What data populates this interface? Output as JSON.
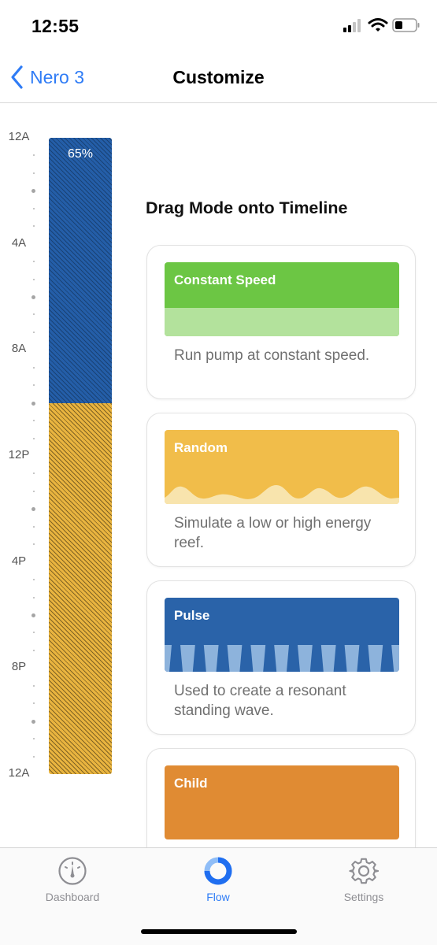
{
  "status_bar": {
    "time": "12:55"
  },
  "nav": {
    "back_label": "Nero 3",
    "title": "Customize"
  },
  "timeline": {
    "labels": [
      "12A",
      "4A",
      "8A",
      "12P",
      "4P",
      "8P",
      "12A"
    ],
    "bar_percent_label": "65%",
    "segments": [
      {
        "mode": "Pulse",
        "color": "#245ea8",
        "start": "12A",
        "end": "10A"
      },
      {
        "mode": "Random",
        "color": "#e9b43f",
        "start": "10A",
        "end": "12A"
      }
    ]
  },
  "modes_panel": {
    "heading": "Drag Mode onto Timeline",
    "modes": [
      {
        "name": "Constant Speed",
        "description": "Run pump at constant speed.",
        "color": "#6cc644",
        "icon": "flat-wave-icon"
      },
      {
        "name": "Random",
        "description": "Simulate a low or high energy reef.",
        "color": "#f1bd4a",
        "icon": "random-wave-icon"
      },
      {
        "name": "Pulse",
        "description": "Used to create a resonant standing wave.",
        "color": "#2a63a9",
        "icon": "pulse-wave-icon"
      },
      {
        "name": "Child",
        "description": "",
        "color": "#e08b33",
        "icon": ""
      }
    ]
  },
  "tab_bar": {
    "tabs": [
      {
        "label": "Dashboard",
        "icon": "gauge-icon",
        "active": false
      },
      {
        "label": "Flow",
        "icon": "flow-ring-icon",
        "active": true
      },
      {
        "label": "Settings",
        "icon": "gear-icon",
        "active": false
      }
    ],
    "active_color": "#2f7cf6"
  }
}
